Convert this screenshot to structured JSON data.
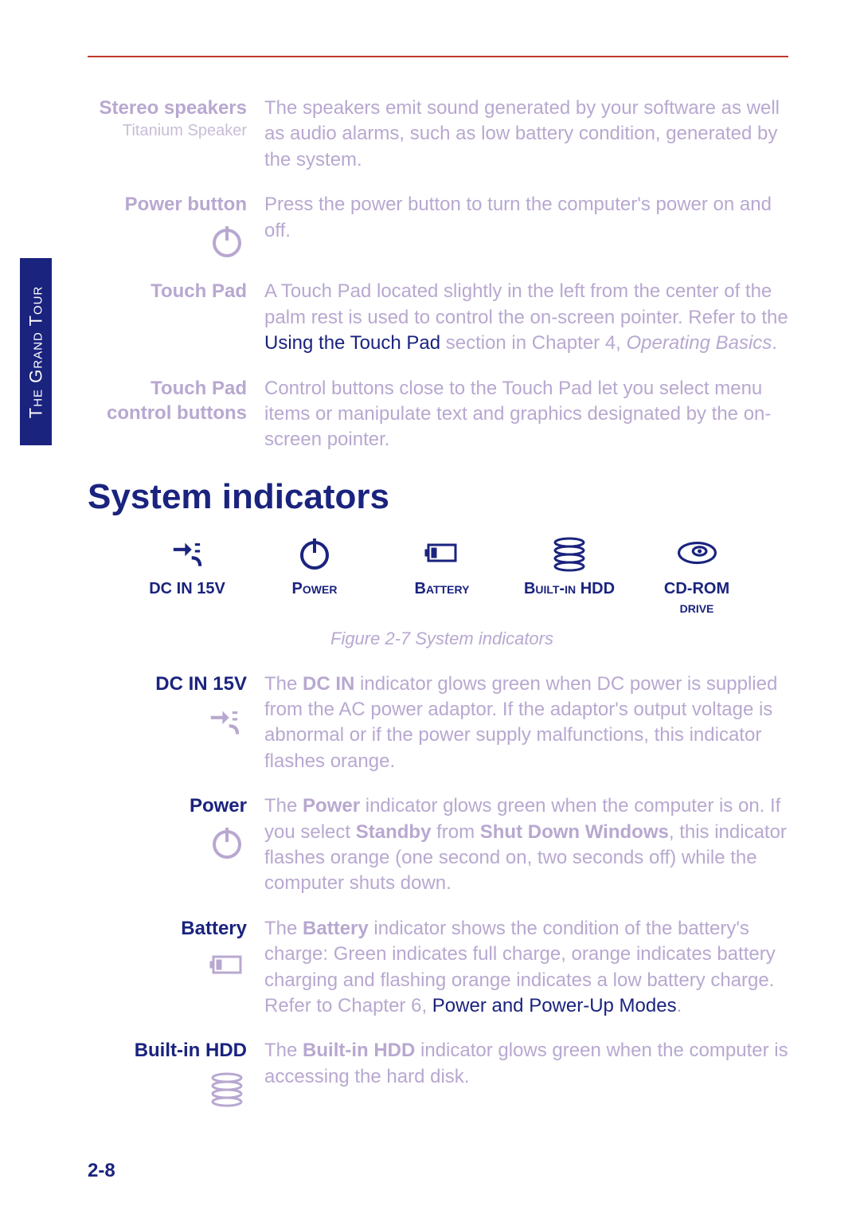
{
  "sidebar": {
    "label": "The Grand Tour"
  },
  "top_items": [
    {
      "label": "Stereo speakers",
      "sublabel": "Titanium Speaker",
      "icon": "",
      "body": "The speakers emit sound generated by your software as well as audio alarms, such as low battery condition, generated by the system."
    },
    {
      "label": "Power button",
      "sublabel": "",
      "icon": "power",
      "body": "Press the power button to turn the computer's power on and off."
    },
    {
      "label": "Touch Pad",
      "sublabel": "",
      "icon": "",
      "body_pre": "A Touch Pad located slightly in the left from the center of the palm rest is used to control the on-screen pointer. Refer to the ",
      "body_link": "Using the Touch Pad",
      "body_post": " section in Chapter 4, ",
      "body_em": "Operating Basics",
      "body_tail": "."
    },
    {
      "label": "Touch Pad control buttons",
      "sublabel": "",
      "icon": "",
      "body": "Control buttons close to the Touch Pad let you select menu items or manipulate text and graphics designated by the on-screen pointer."
    }
  ],
  "section_heading": "System indicators",
  "indicator_icons": [
    {
      "label": "DC IN 15V",
      "icon": "plug"
    },
    {
      "label": "Power",
      "icon": "power"
    },
    {
      "label": "Battery",
      "icon": "battery"
    },
    {
      "label": "Built-in HDD",
      "icon": "hdd"
    },
    {
      "label": "CD-ROM drive",
      "icon": "cdrom"
    }
  ],
  "figure_caption": "Figure 2-7  System indicators",
  "indicator_items": [
    {
      "label": "DC IN 15V",
      "icon": "plug",
      "body_pre": "The ",
      "body_bold": "DC IN",
      "body_post": " indicator glows green when DC power is supplied from the AC power adaptor. If the adaptor's output voltage is abnormal or if the power supply malfunctions, this indicator flashes orange."
    },
    {
      "label": "Power",
      "icon": "power",
      "body_pre": "The ",
      "body_bold": "Power",
      "body_mid": " indicator glows green when the computer is on. If you select ",
      "body_bold2": "Standby",
      "body_mid2": " from ",
      "body_bold3": "Shut Down Windows",
      "body_post": ", this indicator flashes orange (one second on, two seconds off) while the computer shuts down."
    },
    {
      "label": "Battery",
      "icon": "battery",
      "body_pre": "The ",
      "body_bold": "Battery",
      "body_mid": " indicator shows the condition of the battery's charge: Green indicates full charge, orange indicates battery charging and flashing orange indicates a low battery charge. Refer to Chapter 6, ",
      "body_link": "Power and Power-Up Modes",
      "body_post": "."
    },
    {
      "label": "Built-in HDD",
      "icon": "hdd",
      "body_pre": "The ",
      "body_bold": "Built-in HDD",
      "body_post": " indicator glows green when the computer is accessing the hard disk."
    }
  ],
  "page_number": "2-8"
}
